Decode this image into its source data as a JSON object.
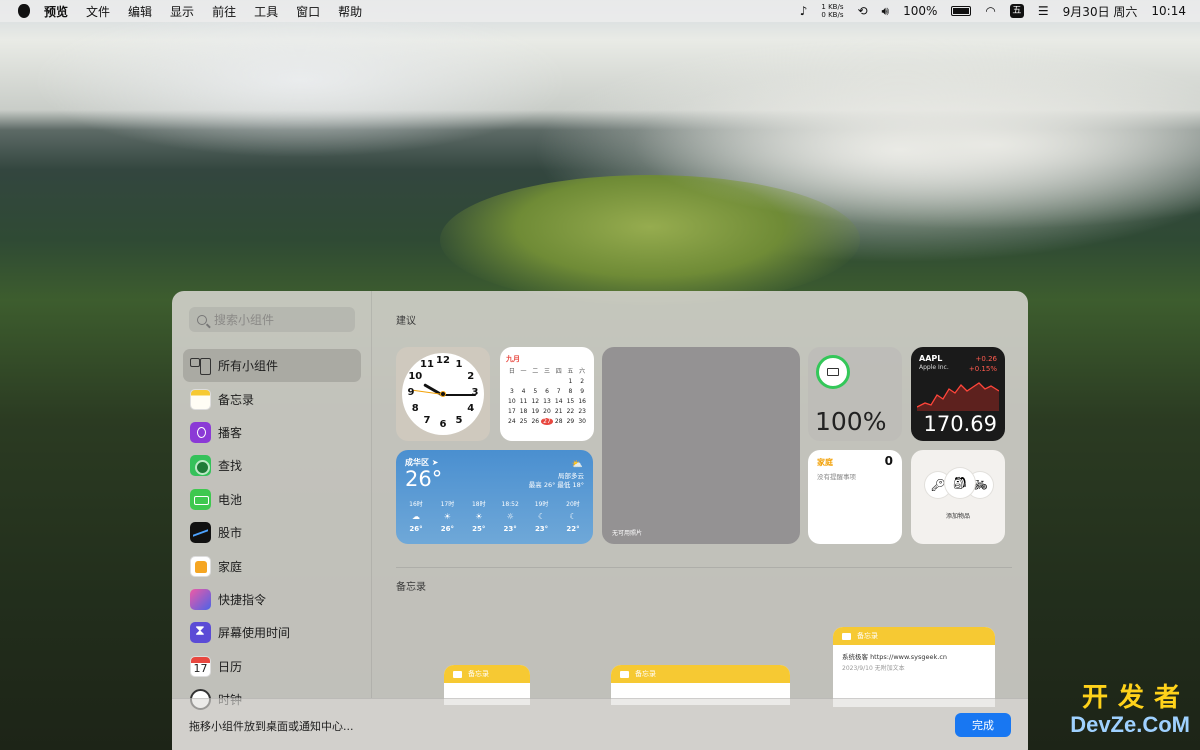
{
  "menubar": {
    "app": "预览",
    "menus": [
      "文件",
      "编辑",
      "显示",
      "前往",
      "工具",
      "窗口",
      "帮助"
    ],
    "net_up": "1 KB/s",
    "net_down": "0 KB/s",
    "battery": "100%",
    "ime": "五",
    "date": "9月30日 周六",
    "time": "10:14"
  },
  "gallery": {
    "search_placeholder": "搜索小组件",
    "sidebar": [
      {
        "label": "所有小组件",
        "icon": "grid-icon",
        "selected": true
      },
      {
        "label": "备忘录",
        "icon": "notes-icon"
      },
      {
        "label": "播客",
        "icon": "podcasts-icon"
      },
      {
        "label": "查找",
        "icon": "find-my-icon"
      },
      {
        "label": "电池",
        "icon": "battery-icon"
      },
      {
        "label": "股市",
        "icon": "stocks-icon"
      },
      {
        "label": "家庭",
        "icon": "home-icon"
      },
      {
        "label": "快捷指令",
        "icon": "shortcuts-icon"
      },
      {
        "label": "屏幕使用时间",
        "icon": "screen-time-icon"
      },
      {
        "label": "日历",
        "icon": "calendar-icon",
        "number": "17"
      },
      {
        "label": "时钟",
        "icon": "clock-icon"
      }
    ],
    "section_suggestions": "建议",
    "section_notes": "备忘录",
    "hint": "拖移小组件放到桌面或通知中心...",
    "done": "完成"
  },
  "widgets": {
    "clock": {
      "numbers": [
        "12",
        "1",
        "2",
        "3",
        "4",
        "5",
        "6",
        "7",
        "8",
        "9",
        "10",
        "11"
      ]
    },
    "calendar": {
      "month": "九月",
      "weekdays": [
        "日",
        "一",
        "二",
        "三",
        "四",
        "五",
        "六"
      ],
      "days": [
        "",
        "",
        "",
        "",
        "",
        "1",
        "2",
        "3",
        "4",
        "5",
        "6",
        "7",
        "8",
        "9",
        "10",
        "11",
        "12",
        "13",
        "14",
        "15",
        "16",
        "17",
        "18",
        "19",
        "20",
        "21",
        "22",
        "23",
        "24",
        "25",
        "26",
        "27",
        "28",
        "29",
        "30"
      ],
      "today": "27"
    },
    "photos": {
      "caption": "无可用照片"
    },
    "battery": {
      "percent": "100%",
      "level": 1.0
    },
    "stocks": {
      "symbol": "AAPL",
      "name": "Apple Inc.",
      "change": "+0.26",
      "change_pct": "+0.15%",
      "price": "170.69"
    },
    "weather": {
      "city": "成华区 ➤",
      "temp": "26°",
      "condition": "局部多云",
      "range": "最高 26° 最低 18°",
      "hours": [
        {
          "time": "16时",
          "icon": "☁",
          "temp": "26°"
        },
        {
          "time": "17时",
          "icon": "☀",
          "temp": "26°"
        },
        {
          "time": "18时",
          "icon": "☀",
          "temp": "25°"
        },
        {
          "time": "18:52",
          "icon": "☼",
          "temp": "23°"
        },
        {
          "time": "19时",
          "icon": "☾",
          "temp": "23°"
        },
        {
          "time": "20时",
          "icon": "☾",
          "temp": "22°"
        }
      ]
    },
    "reminders": {
      "title": "家庭",
      "count": "0",
      "empty": "没有提醒事项"
    },
    "find_items": {
      "caption": "添加物品"
    },
    "notes": [
      {
        "title": "备忘录"
      },
      {
        "title": "备忘录"
      },
      {
        "title": "备忘录",
        "line1": "系统极客 https://www.sysgeek.cn",
        "line2": "2023/9/10  无附加文本"
      }
    ]
  },
  "watermark": {
    "top": "开发者",
    "bottom": "DevZe.CoM"
  }
}
